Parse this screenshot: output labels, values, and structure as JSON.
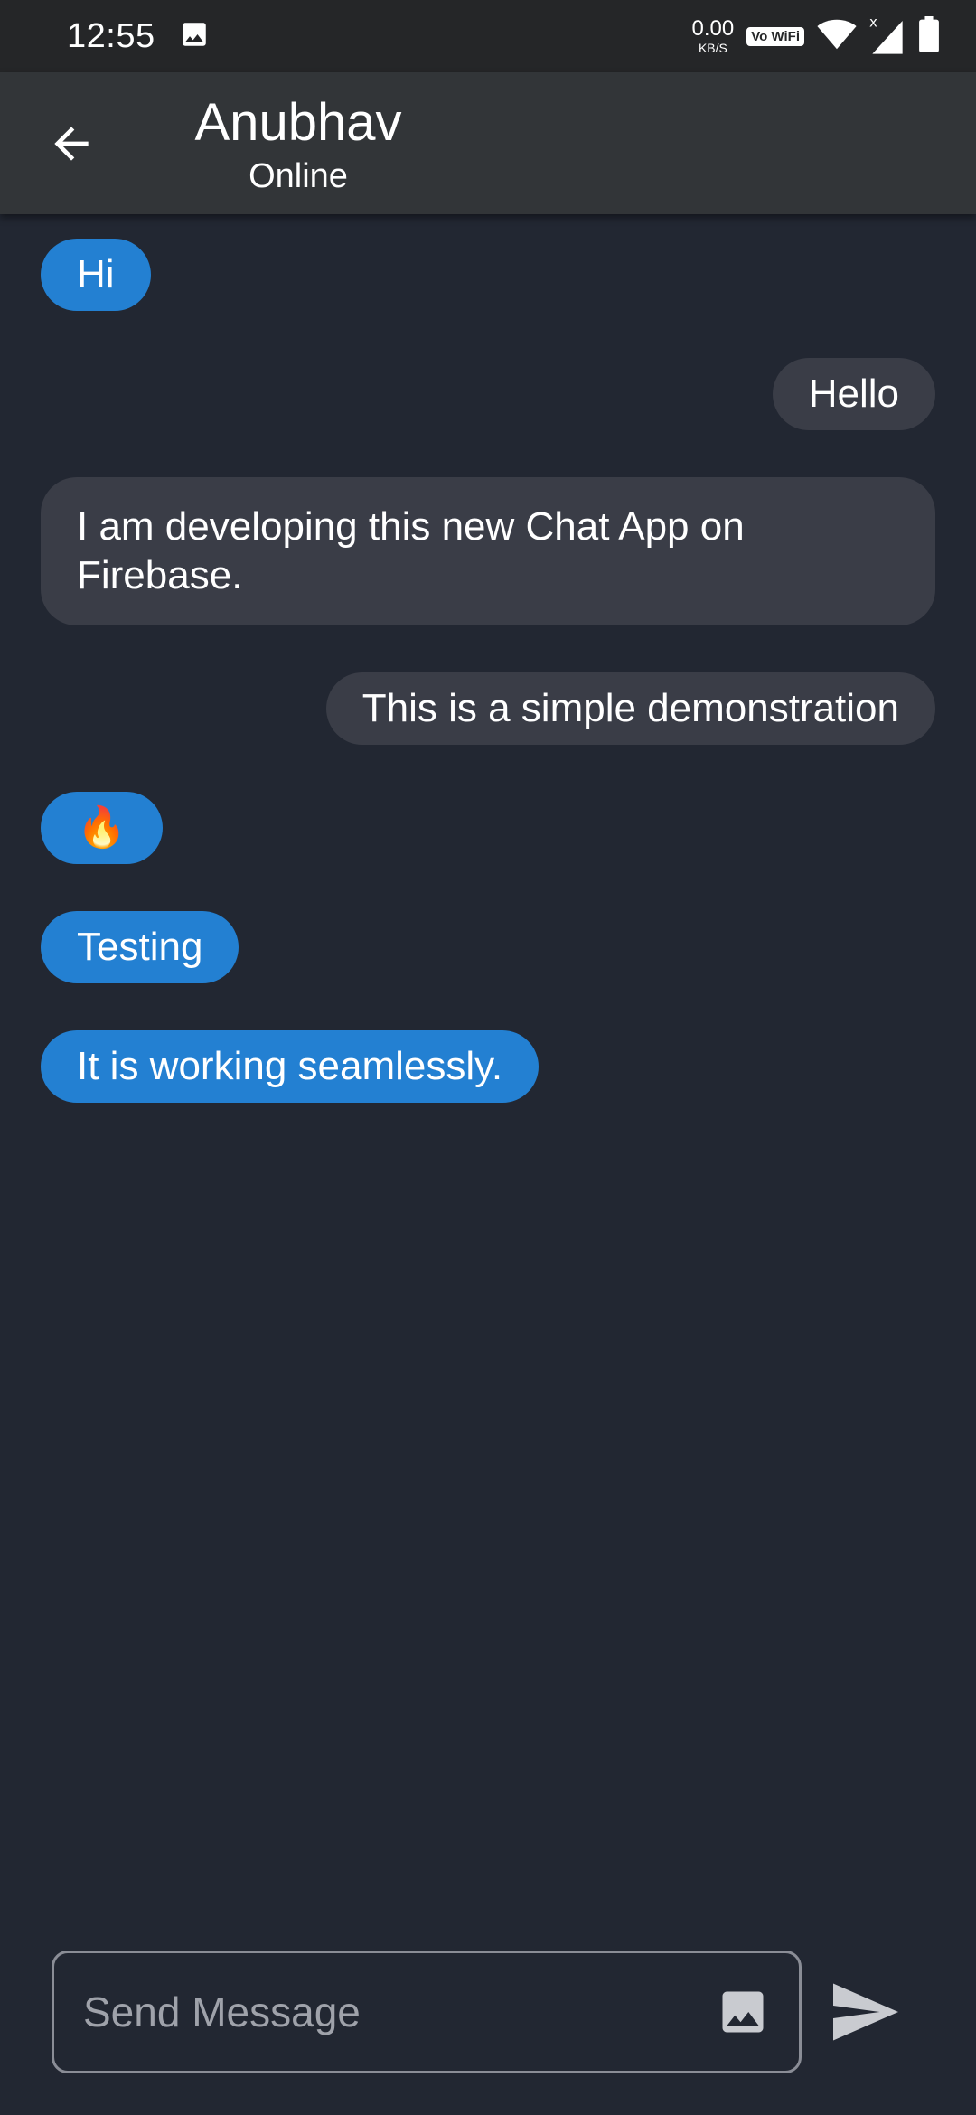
{
  "status_bar": {
    "time": "12:55",
    "net_speed_value": "0.00",
    "net_speed_unit": "KB/S",
    "vowifi": "Vo WiFi",
    "icons": [
      "image-icon",
      "vowifi-icon",
      "wifi-icon",
      "signal-icon",
      "battery-icon"
    ]
  },
  "header": {
    "title": "Anubhav",
    "subtitle": "Online"
  },
  "messages": [
    {
      "text": "Hi",
      "side": "left",
      "style": "blue"
    },
    {
      "text": "Hello",
      "side": "right",
      "style": "grey"
    },
    {
      "text": "I am developing this new Chat App on Firebase.",
      "side": "left",
      "style": "grey"
    },
    {
      "text": "This is a simple demonstration",
      "side": "right",
      "style": "grey"
    },
    {
      "text": "🔥",
      "side": "left",
      "style": "blue"
    },
    {
      "text": "Testing",
      "side": "left",
      "style": "blue"
    },
    {
      "text": "It is working seamlessly.",
      "side": "left",
      "style": "blue"
    }
  ],
  "composer": {
    "placeholder": "Send Message",
    "value": ""
  },
  "colors": {
    "background": "#222732",
    "appbar": "#323538",
    "bubble_blue": "#2380d2",
    "bubble_grey": "#3a3d47"
  }
}
